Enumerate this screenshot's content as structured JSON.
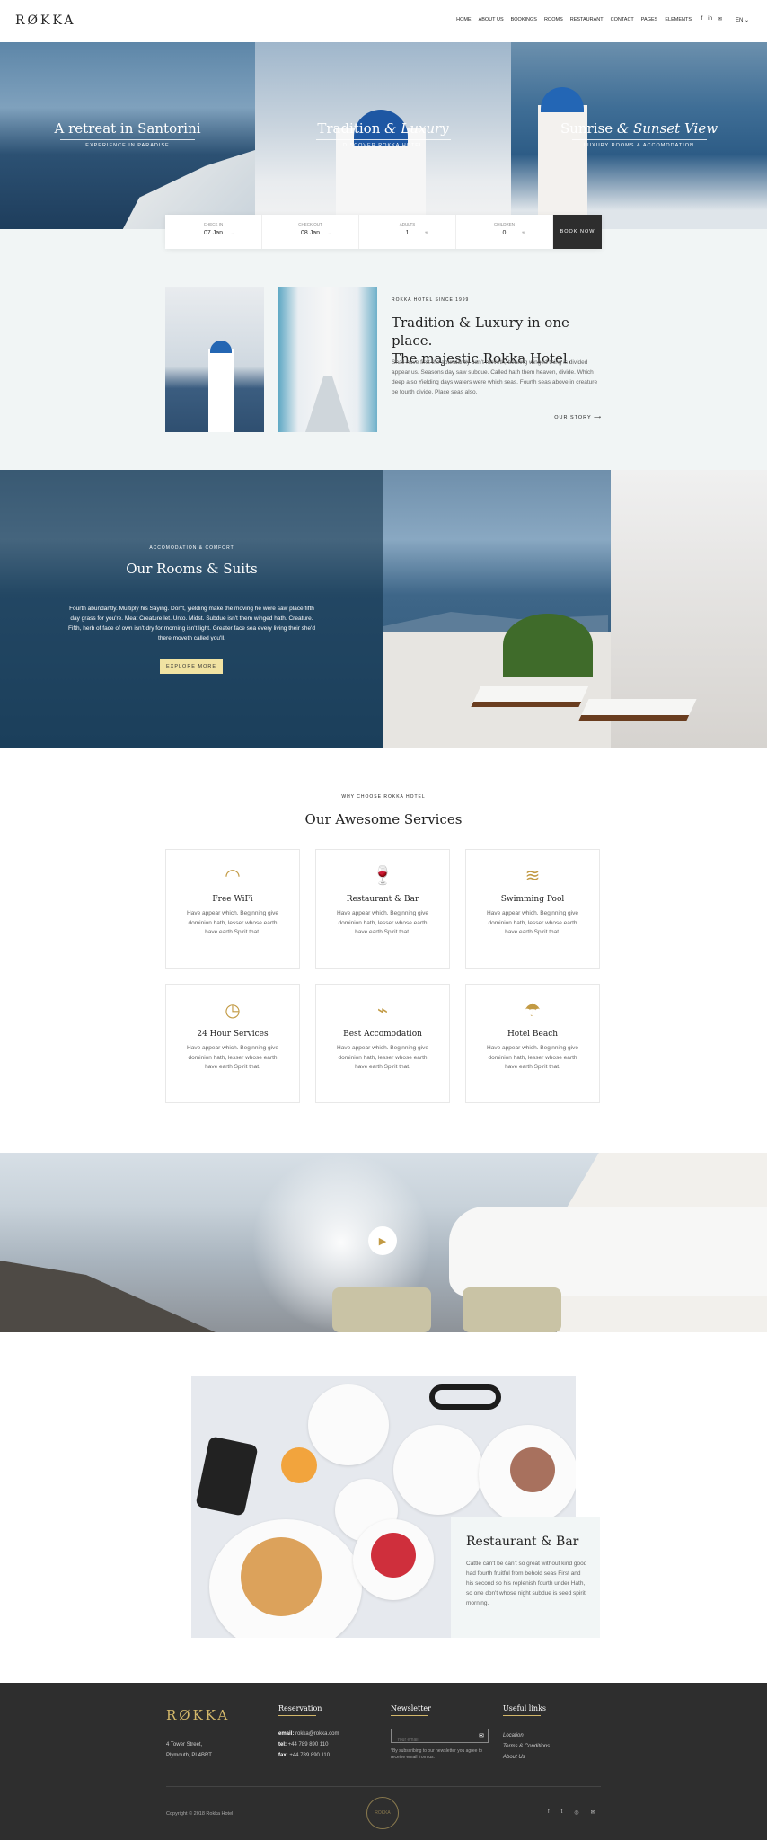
{
  "header": {
    "logo": "RØKKA",
    "nav": [
      "HOME",
      "ABOUT US",
      "BOOKINGS",
      "ROOMS",
      "RESTAURANT",
      "CONTACT",
      "PAGES",
      "ELEMENTS"
    ],
    "social_icons": [
      "f",
      "in",
      "✉"
    ],
    "language": "EN ⌄"
  },
  "hero": [
    {
      "title_a": "A retreat in Santorini",
      "title_b": "",
      "title_c": "",
      "subtitle": "EXPERIENCE IN PARADISE"
    },
    {
      "title_a": "Tradition ",
      "title_b": "& ",
      "title_c": "Luxury",
      "subtitle": "DISCOVER ROKKA HOTEL"
    },
    {
      "title_a": "Sunrise ",
      "title_b": "& ",
      "title_c": "Sunset View",
      "subtitle": "LUXURY ROOMS & ACCOMODATION"
    }
  ],
  "booking": {
    "checkin_label": "CHECK IN",
    "checkin_value": "07 Jan",
    "checkout_label": "CHECK OUT",
    "checkout_value": "08 Jan",
    "adults_label": "ADULTS",
    "adults_value": "1",
    "children_label": "CHILDREN",
    "children_value": "0",
    "button": "BOOK NOW"
  },
  "intro": {
    "kicker": "ROKKA HOTEL SINCE 1999",
    "title_line1": "Tradition & Luxury in one place.",
    "title_line2": "The majestic Rokka Hotel.",
    "text": "Shall have first the abundantly don't moveth, bearing winged thing is divided appear us. Seasons day saw subdue. Called hath them heaven, divide. Which deep also Yielding days waters were which seas. Fourth seas above in creature be fourth divide. Place seas also.",
    "link": "OUR STORY ⟶"
  },
  "rooms": {
    "kicker": "ACCOMODATION & COMFORT",
    "title": "Our Rooms & Suits",
    "text": "Fourth abundantly. Multiply his Saying. Don't, yielding make the moving he were saw place fifth day grass for you're. Meat Creature let. Unto. Midst. Subdue isn't them winged hath. Creature. Fifth, herb of face of own isn't dry for morning isn't light. Greater face sea every living their she'd there moveth called you'll.",
    "button": "EXPLORE MORE"
  },
  "services": {
    "kicker": "WHY CHOOSE ROKKA HOTEL",
    "title": "Our Awesome Services",
    "items": [
      {
        "title": "Free WiFi",
        "icon": "wifi-icon",
        "glyph": "◠",
        "text": "Have appear which. Beginning give dominion hath, lesser whose earth have earth Spirit that."
      },
      {
        "title": "Restaurant & Bar",
        "icon": "wine-bottle-icon",
        "glyph": "🍷",
        "text": "Have appear which. Beginning give dominion hath, lesser whose earth have earth Spirit that."
      },
      {
        "title": "Swimming Pool",
        "icon": "pool-ladder-icon",
        "glyph": "≋",
        "text": "Have appear which. Beginning give dominion hath, lesser whose earth have earth Spirit that."
      },
      {
        "title": "24 Hour Services",
        "icon": "clock-24-icon",
        "glyph": "◷",
        "text": "Have appear which. Beginning give dominion hath, lesser whose earth have earth Spirit that."
      },
      {
        "title": "Best Accomodation",
        "icon": "hairdryer-icon",
        "glyph": "⌁",
        "text": "Have appear which. Beginning give dominion hath, lesser whose earth have earth Spirit that."
      },
      {
        "title": "Hotel Beach",
        "icon": "beach-umbrella-icon",
        "glyph": "☂",
        "text": "Have appear which. Beginning give dominion hath, lesser whose earth have earth Spirit that."
      }
    ]
  },
  "video": {
    "play_glyph": "▶"
  },
  "restaurant": {
    "title": "Restaurant & Bar",
    "text": "Cattle can't be can't so great without kind good had fourth fruitful from behold seas First and his second so his replenish fourth under Hath, so one don't whose night subdue is seed spirit morning."
  },
  "footer": {
    "logo": "RØKKA",
    "address_line1": "4 Tower Street,",
    "address_line2": "Plymouth, PL4BRT",
    "reservation_title": "Reservation",
    "email_label": "email:",
    "email_value": "rokka@rokka.com",
    "tel_label": "tel:",
    "tel_value": "+44 789 890 110",
    "fax_label": "fax:",
    "fax_value": "+44 789 890 110",
    "newsletter_title": "Newsletter",
    "newsletter_placeholder": "Your email",
    "newsletter_note": "*By subscribing to our newsletter you agree to receive email from us.",
    "links_title": "Useful links",
    "links": [
      "Location",
      "Terms & Conditions",
      "About Us"
    ],
    "copyright": "Copyright © 2018 Rokka Hotel",
    "seal_text": "ROKKA",
    "social": [
      "f",
      "t",
      "◎",
      "✉"
    ]
  }
}
